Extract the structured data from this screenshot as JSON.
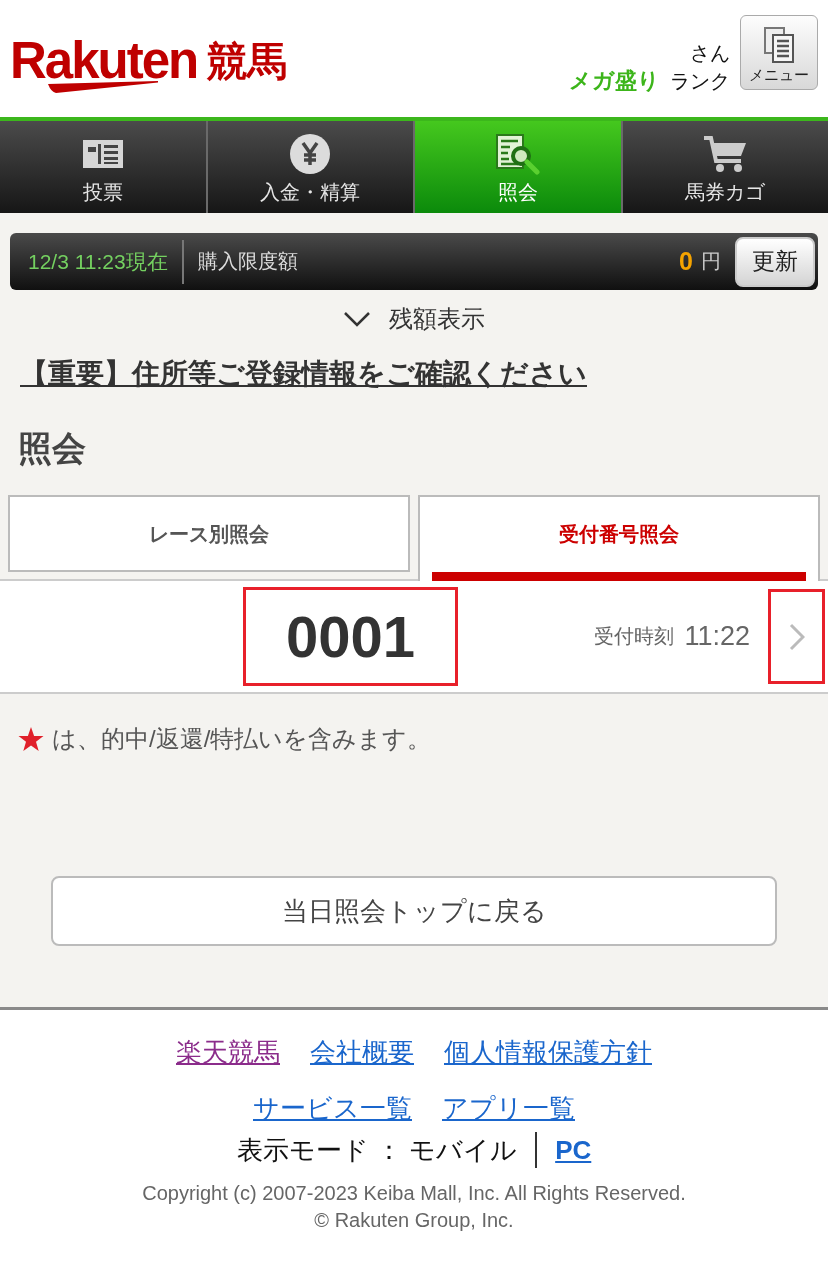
{
  "header": {
    "logo": {
      "wordmark": "Rakuten",
      "service": "競馬"
    },
    "user": {
      "honorific": "さん",
      "rank": "メガ盛り",
      "rank_label": "ランク"
    },
    "menu_button": {
      "label": "メニュー"
    }
  },
  "nav_tabs": [
    {
      "label": "投票",
      "kind": "ballot",
      "selected": false
    },
    {
      "label": "入金・精算",
      "kind": "coin",
      "selected": false
    },
    {
      "label": "照会",
      "kind": "search",
      "selected": true
    },
    {
      "label": "馬券カゴ",
      "kind": "cart",
      "selected": false
    }
  ],
  "balance_bar": {
    "as_of": "12/3 11:23現在",
    "label": "購入限度額",
    "amount": "0",
    "unit": "円",
    "refresh_button": "更新"
  },
  "balance_toggle": {
    "label": "残額表示",
    "expanded": false
  },
  "notice_link": "【重要】住所等ご登録情報をご確認ください",
  "page_title": "照会",
  "sub_tabs": [
    {
      "label": "レース別照会",
      "selected": false
    },
    {
      "label": "受付番号照会",
      "selected": true
    }
  ],
  "receipts": [
    {
      "number": "0001",
      "time_label": "受付時刻",
      "time": "11:22",
      "number_highlighted": true,
      "arrow_highlighted": true
    }
  ],
  "legend": {
    "text": "は、的中/返還/特払いを含みます。"
  },
  "back_button": "当日照会トップに戻る",
  "footer": {
    "link_rows": [
      {
        "links": [
          {
            "label": "楽天競馬",
            "visited": true
          },
          {
            "label": "会社概要",
            "visited": false
          },
          {
            "label": "個人情報保護方針",
            "visited": false
          }
        ]
      },
      {
        "links": [
          {
            "label": "サービス一覧",
            "visited": false
          },
          {
            "label": "アプリ一覧",
            "visited": false
          }
        ]
      }
    ],
    "display_mode": {
      "label": "表示モード ： モバイル",
      "pc_link": "PC"
    },
    "copyright": [
      "Copyright (c) 2007-2023 Keiba Mall, Inc. All Rights Reserved.",
      "© Rakuten Group, Inc."
    ]
  }
}
